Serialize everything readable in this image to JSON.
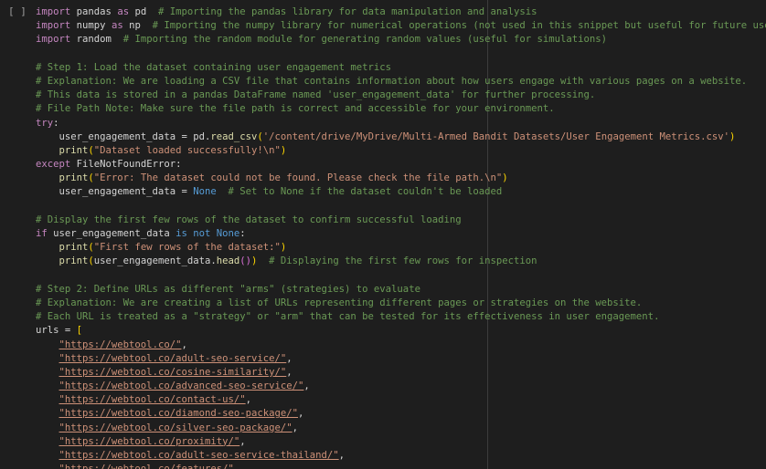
{
  "cell": {
    "run_indicator": "[ ]"
  },
  "lines": [
    [
      [
        "kw",
        "import"
      ],
      [
        "pl",
        " pandas "
      ],
      [
        "kw",
        "as"
      ],
      [
        "pl",
        " pd  "
      ],
      [
        "cm",
        "# Importing the pandas library for data manipulation and analysis"
      ]
    ],
    [
      [
        "kw",
        "import"
      ],
      [
        "pl",
        " numpy "
      ],
      [
        "kw",
        "as"
      ],
      [
        "pl",
        " np  "
      ],
      [
        "cm",
        "# Importing the numpy library for numerical operations (not used in this snippet but useful for future use)"
      ]
    ],
    [
      [
        "kw",
        "import"
      ],
      [
        "pl",
        " random  "
      ],
      [
        "cm",
        "# Importing the random module for generating random values (useful for simulations)"
      ]
    ],
    [],
    [
      [
        "cm",
        "# Step 1: Load the dataset containing user engagement metrics"
      ]
    ],
    [
      [
        "cm",
        "# Explanation: We are loading a CSV file that contains information about how users engage with various pages on a website."
      ]
    ],
    [
      [
        "cm",
        "# This data is stored in a pandas DataFrame named 'user_engagement_data' for further processing."
      ]
    ],
    [
      [
        "cm",
        "# File Path Note: Make sure the file path is correct and accessible for your environment."
      ]
    ],
    [
      [
        "kw",
        "try"
      ],
      [
        "pl",
        ":"
      ]
    ],
    [
      [
        "pl",
        "    user_engagement_data = pd."
      ],
      [
        "fn",
        "read_csv"
      ],
      [
        "br",
        "("
      ],
      [
        "st",
        "'/content/drive/MyDrive/Multi-Armed Bandit Datasets/User Engagement Metrics.csv'"
      ],
      [
        "br",
        ")"
      ]
    ],
    [
      [
        "pl",
        "    "
      ],
      [
        "fn",
        "print"
      ],
      [
        "br",
        "("
      ],
      [
        "st",
        "\"Dataset loaded successfully!\\n\""
      ],
      [
        "br",
        ")"
      ]
    ],
    [
      [
        "kw",
        "except"
      ],
      [
        "pl",
        " FileNotFoundError:"
      ]
    ],
    [
      [
        "pl",
        "    "
      ],
      [
        "fn",
        "print"
      ],
      [
        "br",
        "("
      ],
      [
        "st",
        "\"Error: The dataset could not be found. Please check the file path.\\n\""
      ],
      [
        "br",
        ")"
      ]
    ],
    [
      [
        "pl",
        "    user_engagement_data = "
      ],
      [
        "kw2",
        "None"
      ],
      [
        "pl",
        "  "
      ],
      [
        "cm",
        "# Set to None if the dataset couldn't be loaded"
      ]
    ],
    [],
    [
      [
        "cm",
        "# Display the first few rows of the dataset to confirm successful loading"
      ]
    ],
    [
      [
        "kw",
        "if"
      ],
      [
        "pl",
        " user_engagement_data "
      ],
      [
        "kw2",
        "is not"
      ],
      [
        "pl",
        " "
      ],
      [
        "kw2",
        "None"
      ],
      [
        "pl",
        ":"
      ]
    ],
    [
      [
        "pl",
        "    "
      ],
      [
        "fn",
        "print"
      ],
      [
        "br",
        "("
      ],
      [
        "st",
        "\"First few rows of the dataset:\""
      ],
      [
        "br",
        ")"
      ]
    ],
    [
      [
        "pl",
        "    "
      ],
      [
        "fn",
        "print"
      ],
      [
        "br",
        "("
      ],
      [
        "pl",
        "user_engagement_data."
      ],
      [
        "fn",
        "head"
      ],
      [
        "br2",
        "()"
      ],
      [
        "br",
        ")"
      ],
      [
        "pl",
        "  "
      ],
      [
        "cm",
        "# Displaying the first few rows for inspection"
      ]
    ],
    [],
    [
      [
        "cm",
        "# Step 2: Define URLs as different \"arms\" (strategies) to evaluate"
      ]
    ],
    [
      [
        "cm",
        "# Explanation: We are creating a list of URLs representing different pages or strategies on the website."
      ]
    ],
    [
      [
        "cm",
        "# Each URL is treated as a \"strategy\" or \"arm\" that can be tested for its effectiveness in user engagement."
      ]
    ],
    [
      [
        "pl",
        "urls = "
      ],
      [
        "br",
        "["
      ]
    ],
    [
      [
        "pl",
        "    "
      ],
      [
        "stu",
        "\"https://webtool.co/\""
      ],
      [
        "pl",
        ","
      ]
    ],
    [
      [
        "pl",
        "    "
      ],
      [
        "stu",
        "\"https://webtool.co/adult-seo-service/\""
      ],
      [
        "pl",
        ","
      ]
    ],
    [
      [
        "pl",
        "    "
      ],
      [
        "stu",
        "\"https://webtool.co/cosine-similarity/\""
      ],
      [
        "pl",
        ","
      ]
    ],
    [
      [
        "pl",
        "    "
      ],
      [
        "stu",
        "\"https://webtool.co/advanced-seo-service/\""
      ],
      [
        "pl",
        ","
      ]
    ],
    [
      [
        "pl",
        "    "
      ],
      [
        "stu",
        "\"https://webtool.co/contact-us/\""
      ],
      [
        "pl",
        ","
      ]
    ],
    [
      [
        "pl",
        "    "
      ],
      [
        "stu",
        "\"https://webtool.co/diamond-seo-package/\""
      ],
      [
        "pl",
        ","
      ]
    ],
    [
      [
        "pl",
        "    "
      ],
      [
        "stu",
        "\"https://webtool.co/silver-seo-package/\""
      ],
      [
        "pl",
        ","
      ]
    ],
    [
      [
        "pl",
        "    "
      ],
      [
        "stu",
        "\"https://webtool.co/proximity/\""
      ],
      [
        "pl",
        ","
      ]
    ],
    [
      [
        "pl",
        "    "
      ],
      [
        "stu",
        "\"https://webtool.co/adult-seo-service-thailand/\""
      ],
      [
        "pl",
        ","
      ]
    ],
    [
      [
        "pl",
        "    "
      ],
      [
        "stu",
        "\"https://webtool.co/features/\""
      ],
      [
        "pl",
        ","
      ]
    ]
  ]
}
